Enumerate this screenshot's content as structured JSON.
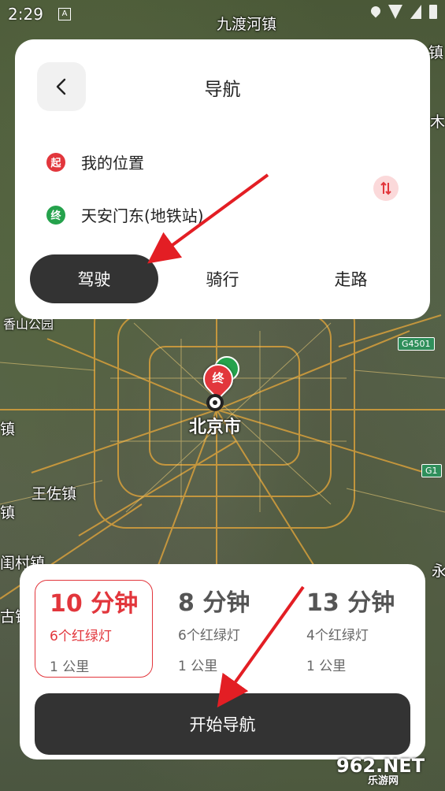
{
  "status_bar": {
    "time": "2:29",
    "indicator": "A"
  },
  "map": {
    "labels": {
      "city": "北京市",
      "jiudu": "九渡河镇",
      "xiangshan": "香山公园",
      "wangzuo": "王佐镇",
      "guancun": "闺村镇",
      "zhen_left": "镇",
      "zhen_left2": "镇",
      "gu": "古镇",
      "mu": "木",
      "zhen_right": "镇",
      "yong": "永"
    },
    "shields": {
      "g4501": "G4501",
      "g1": "G1"
    },
    "end_marker": "终"
  },
  "nav_panel": {
    "title": "导航",
    "start": {
      "badge": "起",
      "label": "我的位置"
    },
    "end": {
      "badge": "终",
      "label": "天安门东(地铁站)"
    },
    "modes": [
      "驾驶",
      "骑行",
      "走路"
    ],
    "active_mode": "驾驶"
  },
  "routes": [
    {
      "time": "10 分钟",
      "lights": "6个红绿灯",
      "distance": "1 公里",
      "selected": true
    },
    {
      "time": "8 分钟",
      "lights": "6个红绿灯",
      "distance": "1 公里",
      "selected": false
    },
    {
      "time": "13 分钟",
      "lights": "4个红绿灯",
      "distance": "1 公里",
      "selected": false
    }
  ],
  "start_button": "开始导航",
  "watermark": {
    "logo": "962.NET",
    "sub": "乐游网"
  },
  "colors": {
    "accent_red": "#e2363c",
    "accent_green": "#25a24c",
    "dark_button": "#333333"
  }
}
